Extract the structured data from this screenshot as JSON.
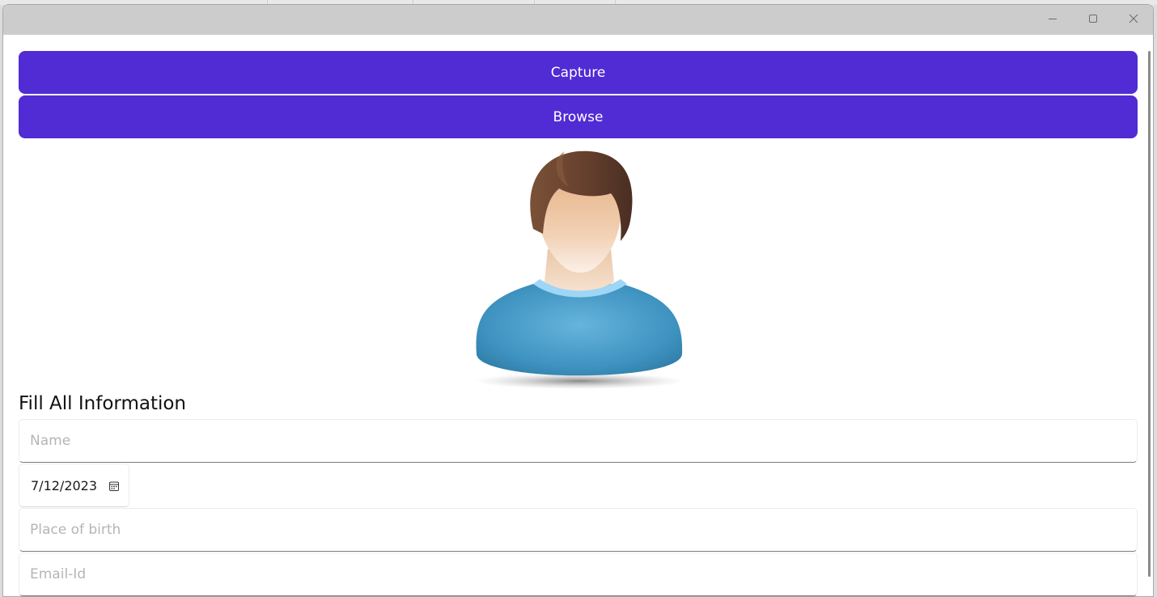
{
  "window": {
    "controls": {
      "minimize_icon": "minimize-icon",
      "maximize_icon": "maximize-icon",
      "close_icon": "close-icon"
    }
  },
  "actions": {
    "capture_label": "Capture",
    "browse_label": "Browse"
  },
  "profile_image": {
    "icon": "user-avatar-icon"
  },
  "form": {
    "title": "Fill All Information",
    "name": {
      "placeholder": "Name",
      "value": ""
    },
    "date_of_birth": {
      "value": "7/12/2023",
      "icon": "calendar-icon"
    },
    "place_of_birth": {
      "placeholder": "Place of birth",
      "value": ""
    },
    "email": {
      "placeholder": "Email-Id",
      "value": ""
    }
  },
  "colors": {
    "accent": "#512bd4",
    "titlebar": "#cccccc",
    "placeholder_text": "#b5b5b5"
  }
}
